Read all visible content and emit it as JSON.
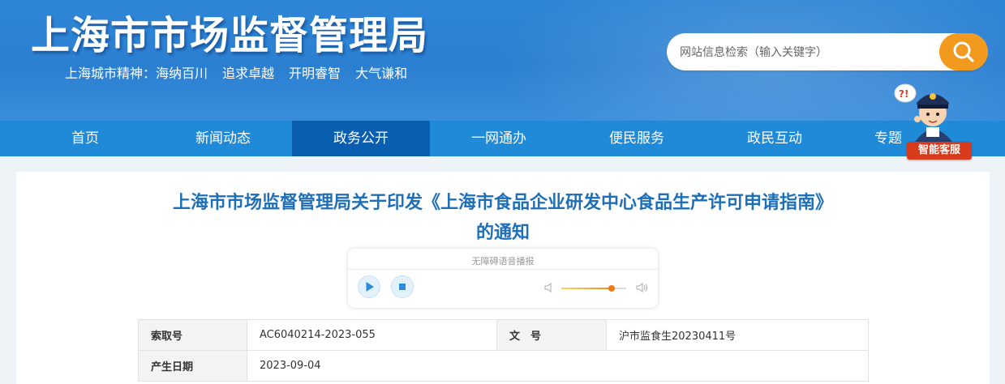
{
  "header": {
    "site_title": "上海市市场监督管理局",
    "slogan": {
      "prefix": "上海城市精神：",
      "items": [
        "海纳百川",
        "追求卓越",
        "开明睿智",
        "大气谦和"
      ]
    },
    "search": {
      "placeholder": "网站信息检索（输入关键字）",
      "icon": "search-icon"
    }
  },
  "nav": {
    "items": [
      {
        "label": "首页"
      },
      {
        "label": "新闻动态"
      },
      {
        "label": "政务公开"
      },
      {
        "label": "一网通办"
      },
      {
        "label": "便民服务"
      },
      {
        "label": "政民互动"
      },
      {
        "label": "专题"
      }
    ],
    "active_index": 2
  },
  "assistant": {
    "label": "智能客服",
    "icon": "police-mascot-icon"
  },
  "article": {
    "title_line1": "上海市市场监督管理局关于印发《上海市食品企业研发中心食品生产许可申请指南》",
    "title_line2": "的通知"
  },
  "player": {
    "label": "无障碍语音播报",
    "play_icon": "play-icon",
    "stop_icon": "stop-icon",
    "volume_level": 0.78
  },
  "info": {
    "rows": [
      [
        {
          "k": "索取号",
          "v": "AC6040214-2023-055"
        },
        {
          "k": "文　号",
          "v": "沪市监食生20230411号"
        }
      ],
      [
        {
          "k": "产生日期",
          "v": "2023-09-04"
        }
      ]
    ]
  },
  "colors": {
    "header_blue": "#2b7fd1",
    "nav_blue": "#1f8ad8",
    "nav_active": "#0a5eaf",
    "search_orange": "#f29a1d",
    "title_blue": "#1e6fb8",
    "assistant_red": "#d83a1c"
  }
}
